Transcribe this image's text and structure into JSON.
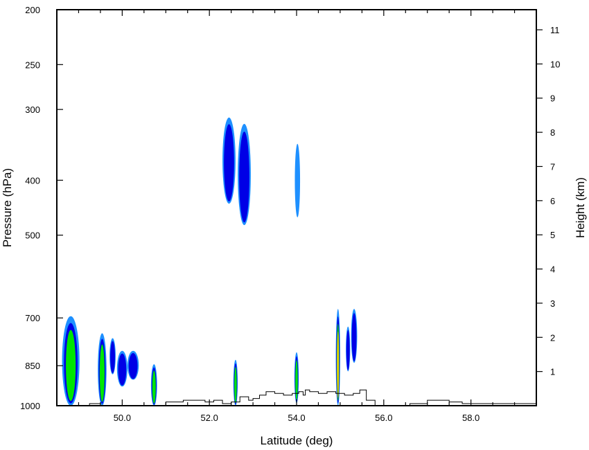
{
  "chart_data": {
    "type": "contour",
    "xlabel": "Latitude (deg)",
    "ylabel_left": "Pressure (hPa)",
    "ylabel_right": "Height (km)",
    "xlim": [
      48.5,
      59.5
    ],
    "x_ticks": [
      50.0,
      52.0,
      54.0,
      56.0,
      58.0
    ],
    "x_tick_labels": [
      "50.0",
      "52.0",
      "54.0",
      "56.0",
      "58.0"
    ],
    "x_minor_step": 0.5,
    "ylim_pressure": [
      1000,
      200
    ],
    "y_scale": "log",
    "pressure_ticks": [
      200,
      250,
      300,
      400,
      500,
      700,
      850,
      1000
    ],
    "pressure_tick_labels": [
      "200",
      "250",
      "300",
      "400",
      "500",
      "700",
      "850",
      "1000"
    ],
    "height_ticks": [
      1,
      2,
      3,
      4,
      5,
      6,
      7,
      8,
      9,
      10,
      11
    ],
    "height_tick_labels": [
      "1",
      "2",
      "3",
      "4",
      "5",
      "6",
      "7",
      "8",
      "9",
      "10",
      "11"
    ],
    "contour_colors": [
      "#1e90ff",
      "#0000e6",
      "#00e600",
      "#e6d200"
    ],
    "contour_levels": [
      {
        "level": 1,
        "color": "#1e90ff"
      },
      {
        "level": 2,
        "color": "#0000e6"
      },
      {
        "level": 3,
        "color": "#00e600"
      },
      {
        "level": 4,
        "color": "#e6d200"
      }
    ],
    "blobs": [
      {
        "lat": 48.82,
        "lat_halfwidth": 0.2,
        "p_top": 695,
        "p_bottom": 1000,
        "max_level": 3
      },
      {
        "lat": 49.54,
        "lat_halfwidth": 0.1,
        "p_top": 745,
        "p_bottom": 1000,
        "max_level": 3
      },
      {
        "lat": 49.78,
        "lat_halfwidth": 0.07,
        "p_top": 760,
        "p_bottom": 880,
        "max_level": 2
      },
      {
        "lat": 50.0,
        "lat_halfwidth": 0.12,
        "p_top": 800,
        "p_bottom": 925,
        "max_level": 2
      },
      {
        "lat": 50.25,
        "lat_halfwidth": 0.13,
        "p_top": 800,
        "p_bottom": 900,
        "max_level": 2
      },
      {
        "lat": 50.73,
        "lat_halfwidth": 0.07,
        "p_top": 845,
        "p_bottom": 1000,
        "max_level": 3
      },
      {
        "lat": 52.45,
        "lat_halfwidth": 0.15,
        "p_top": 310,
        "p_bottom": 440,
        "max_level": 2
      },
      {
        "lat": 52.8,
        "lat_halfwidth": 0.15,
        "p_top": 318,
        "p_bottom": 480,
        "max_level": 2
      },
      {
        "lat": 52.6,
        "lat_halfwidth": 0.05,
        "p_top": 830,
        "p_bottom": 1000,
        "max_level": 3
      },
      {
        "lat": 54.02,
        "lat_halfwidth": 0.06,
        "p_top": 345,
        "p_bottom": 465,
        "max_level": 1
      },
      {
        "lat": 54.0,
        "lat_halfwidth": 0.05,
        "p_top": 805,
        "p_bottom": 990,
        "max_level": 3
      },
      {
        "lat": 54.95,
        "lat_halfwidth": 0.05,
        "p_top": 675,
        "p_bottom": 1000,
        "max_level": 4
      },
      {
        "lat": 55.18,
        "lat_halfwidth": 0.05,
        "p_top": 725,
        "p_bottom": 870,
        "max_level": 2
      },
      {
        "lat": 55.32,
        "lat_halfwidth": 0.07,
        "p_top": 675,
        "p_bottom": 840,
        "max_level": 2
      }
    ],
    "terrain_height_km": [
      [
        48.5,
        0.0
      ],
      [
        49.25,
        0.05
      ],
      [
        49.5,
        0.0
      ],
      [
        51.0,
        0.1
      ],
      [
        51.4,
        0.15
      ],
      [
        51.9,
        0.1
      ],
      [
        52.1,
        0.15
      ],
      [
        52.3,
        0.05
      ],
      [
        52.5,
        0.1
      ],
      [
        52.7,
        0.25
      ],
      [
        52.9,
        0.15
      ],
      [
        53.0,
        0.2
      ],
      [
        53.15,
        0.3
      ],
      [
        53.3,
        0.4
      ],
      [
        53.5,
        0.35
      ],
      [
        53.7,
        0.3
      ],
      [
        53.9,
        0.35
      ],
      [
        54.05,
        0.4
      ],
      [
        54.15,
        0.3
      ],
      [
        54.2,
        0.45
      ],
      [
        54.3,
        0.4
      ],
      [
        54.5,
        0.35
      ],
      [
        54.7,
        0.4
      ],
      [
        54.9,
        0.35
      ],
      [
        55.1,
        0.3
      ],
      [
        55.3,
        0.35
      ],
      [
        55.45,
        0.45
      ],
      [
        55.6,
        0.15
      ],
      [
        55.8,
        0.0
      ],
      [
        56.6,
        0.05
      ],
      [
        57.0,
        0.15
      ],
      [
        57.5,
        0.1
      ],
      [
        57.8,
        0.05
      ],
      [
        58.1,
        0.05
      ],
      [
        59.5,
        0.05
      ]
    ]
  }
}
